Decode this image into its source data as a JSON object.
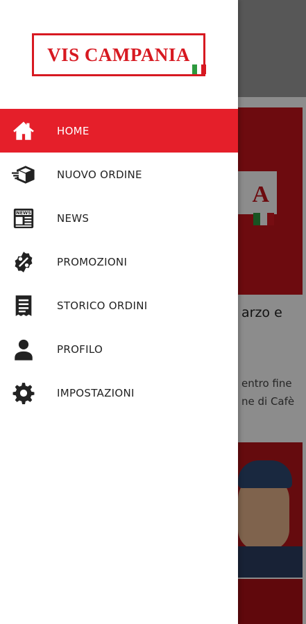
{
  "brand": {
    "name": "VIS CAMPANIA",
    "color": "#d71921",
    "flag": [
      "#2d9a3e",
      "#ffffff",
      "#d71921"
    ]
  },
  "menu": {
    "active_color": "#e51f2a",
    "items": [
      {
        "label": "HOME",
        "icon": "home-icon",
        "active": true
      },
      {
        "label": "NUOVO ORDINE",
        "icon": "delivery-box-icon",
        "active": false
      },
      {
        "label": "NEWS",
        "icon": "newspaper-icon",
        "active": false
      },
      {
        "label": "PROMOZIONI",
        "icon": "percent-badge-icon",
        "active": false
      },
      {
        "label": "STORICO ORDINI",
        "icon": "receipt-list-icon",
        "active": false
      },
      {
        "label": "PROFILO",
        "icon": "user-icon",
        "active": false
      },
      {
        "label": "IMPOSTAZIONI",
        "icon": "gear-icon",
        "active": false
      }
    ]
  },
  "background": {
    "hero_logo_letter": "A",
    "headline_fragment": "arzo e",
    "excerpt_line_1": "entro fine",
    "excerpt_line_2": "ne di Cafè"
  }
}
